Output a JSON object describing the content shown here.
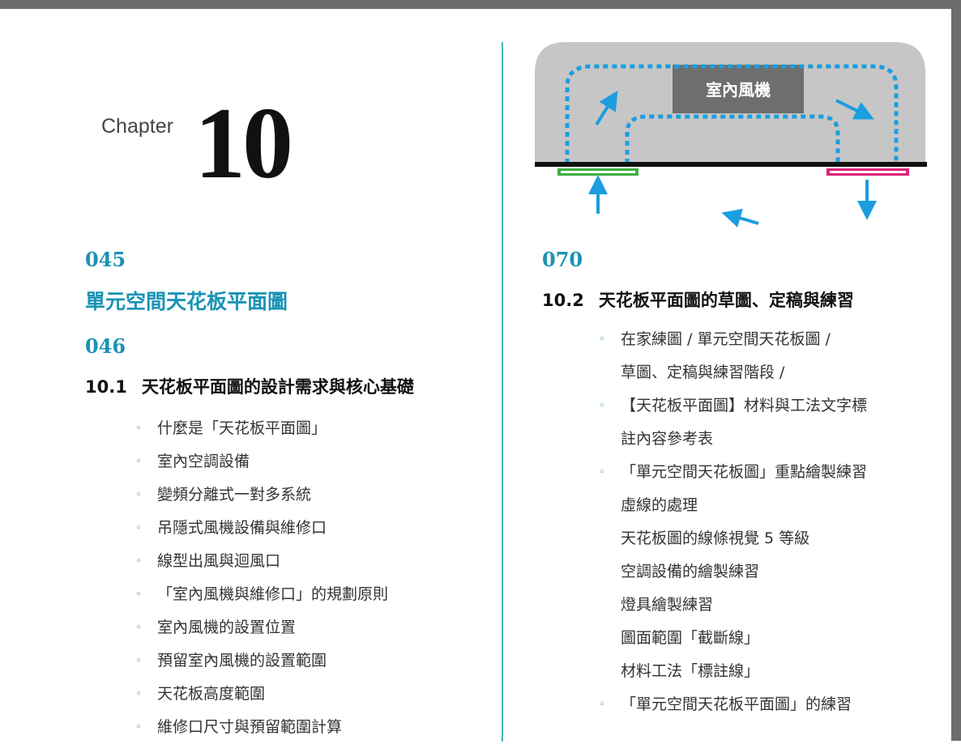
{
  "chapter": {
    "word": "Chapter",
    "number": "10"
  },
  "left": {
    "page_a": "045",
    "part_title": "單元空間天花板平面圖",
    "page_b": "046",
    "section_num": "10.1",
    "section_title": "天花板平面圖的設計需求與核心基礎",
    "items": [
      "什麼是「天花板平面圖」",
      "室內空調設備",
      "變頻分離式一對多系統",
      "吊隱式風機設備與維修口",
      "線型出風與迴風口",
      "「室內風機與維修口」的規劃原則",
      "室內風機的設置位置",
      "預留室內風機的設置範圍",
      "天花板高度範圍",
      "維修口尺寸與預留範圍計算"
    ]
  },
  "right": {
    "diagram_label": "室內風機",
    "page": "070",
    "section_num": "10.2",
    "section_title": "天花板平面圖的草圖、定稿與練習",
    "items": [
      {
        "text": "在家練圖 / 單元空間天花板圖 /",
        "bullet": true
      },
      {
        "text": "草圖、定稿與練習階段 /",
        "bullet": false
      },
      {
        "text": "【天花板平面圖】材料與工法文字標",
        "bullet": true
      },
      {
        "text": "註內容參考表",
        "bullet": false
      },
      {
        "text": "「單元空間天花板圖」重點繪製練習",
        "bullet": true
      },
      {
        "text": "虛線的處理",
        "bullet": false
      },
      {
        "text": "天花板圖的線條視覺 5 等級",
        "bullet": false
      },
      {
        "text": "空調設備的繪製練習",
        "bullet": false
      },
      {
        "text": "燈具繪製練習",
        "bullet": false
      },
      {
        "text": "圖面範圍「截斷線」",
        "bullet": false
      },
      {
        "text": "材料工法「標註線」",
        "bullet": false
      },
      {
        "text": "「單元空間天花板平面圖」的練習",
        "bullet": true
      }
    ]
  },
  "colors": {
    "accent": "#1a93b4",
    "arrow": "#1a9ee0",
    "intake": "#3cb043",
    "outlet": "#e0227a"
  }
}
